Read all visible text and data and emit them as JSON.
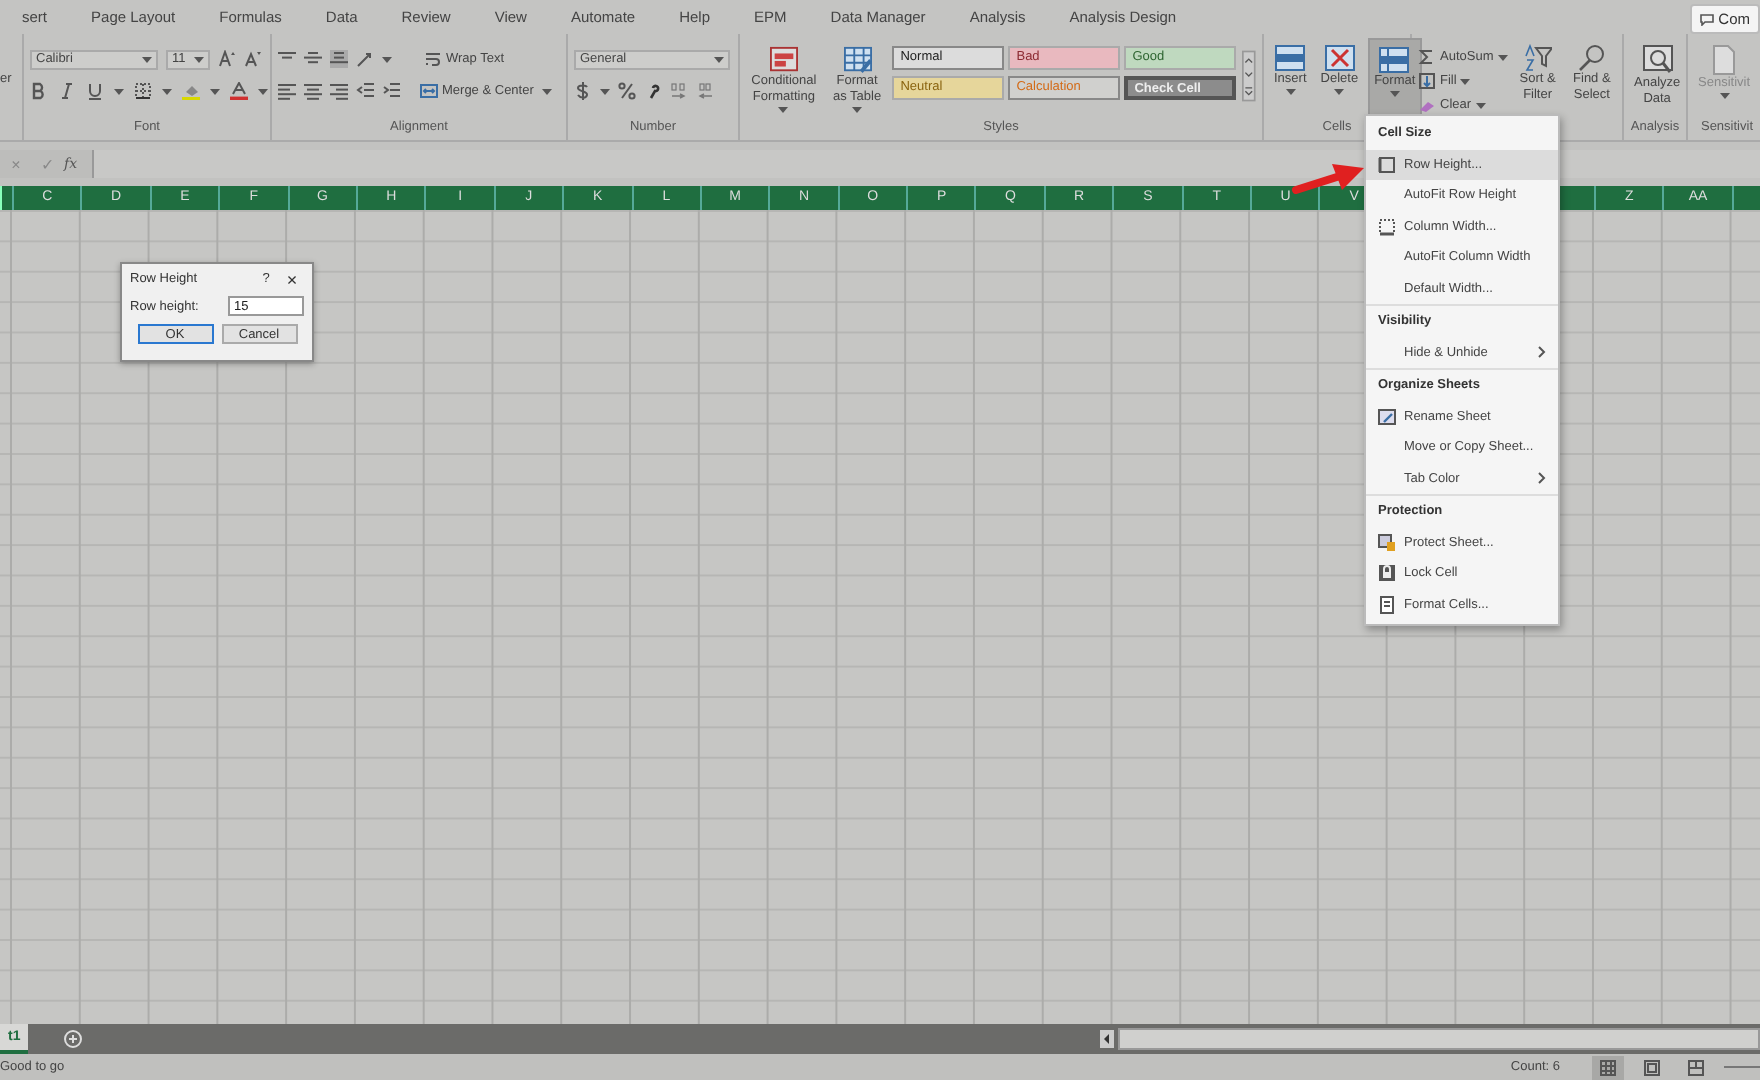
{
  "ribbon_tabs": [
    {
      "label": "sert"
    },
    {
      "label": "Page Layout"
    },
    {
      "label": "Formulas"
    },
    {
      "label": "Data"
    },
    {
      "label": "Review"
    },
    {
      "label": "View"
    },
    {
      "label": "Automate"
    },
    {
      "label": "Help"
    },
    {
      "label": "EPM"
    },
    {
      "label": "Data Manager"
    },
    {
      "label": "Analysis"
    },
    {
      "label": "Analysis Design"
    }
  ],
  "comments_button": "Com",
  "ribbon": {
    "groups": [
      {
        "kind": "clipboard",
        "fragment": "er"
      },
      {
        "kind": "font",
        "font_name": "Calibri",
        "font_size": "11",
        "label": "Font"
      },
      {
        "kind": "alignment",
        "wrap_text": "Wrap Text",
        "merge": "Merge & Center",
        "label": "Alignment"
      },
      {
        "kind": "number",
        "format": "General",
        "label": "Number"
      },
      {
        "kind": "styles",
        "buttons": [
          "Conditional Formatting",
          "Format as Table"
        ],
        "cells": [
          {
            "kind": "normal",
            "label": "Normal"
          },
          {
            "kind": "bad",
            "label": "Bad"
          },
          {
            "kind": "good",
            "label": "Good"
          },
          {
            "kind": "neutral",
            "label": "Neutral"
          },
          {
            "kind": "calculation",
            "label": "Calculation"
          },
          {
            "kind": "check",
            "label": "Check Cell"
          }
        ],
        "label": "Styles"
      },
      {
        "kind": "cells",
        "buttons": [
          {
            "label": "Insert",
            "selected": false
          },
          {
            "label": "Delete",
            "selected": false
          },
          {
            "label": "Format",
            "selected": true
          }
        ],
        "label": "Cells"
      },
      {
        "kind": "editing",
        "items": [
          "AutoSum",
          "Fill",
          "Clear"
        ],
        "buttons": [
          "Sort & Filter",
          "Find & Select"
        ]
      },
      {
        "kind": "analysis",
        "buttons": [
          "Analyze Data"
        ],
        "label": "Analysis"
      },
      {
        "kind": "sensitivity",
        "buttons": [
          "Sensitivit"
        ],
        "label": "Sensitivit"
      }
    ]
  },
  "formula_bar": {
    "cancel": "×",
    "enter": "✓",
    "function": "fx"
  },
  "columns": [
    {
      "kind": "label",
      "label": "C"
    },
    {
      "kind": "label",
      "label": "D"
    },
    {
      "kind": "label",
      "label": "E"
    },
    {
      "kind": "label",
      "label": "F"
    },
    {
      "kind": "label",
      "label": "G"
    },
    {
      "kind": "label",
      "label": "H"
    },
    {
      "kind": "label",
      "label": "I"
    },
    {
      "kind": "label",
      "label": "J"
    },
    {
      "kind": "label",
      "label": "K"
    },
    {
      "kind": "label",
      "label": "L"
    },
    {
      "kind": "label",
      "label": "M"
    },
    {
      "kind": "label",
      "label": "N"
    },
    {
      "kind": "label",
      "label": "O"
    },
    {
      "kind": "label",
      "label": "P"
    },
    {
      "kind": "label",
      "label": "Q"
    },
    {
      "kind": "label",
      "label": "R"
    },
    {
      "kind": "label",
      "label": "S"
    },
    {
      "kind": "label",
      "label": "T"
    },
    {
      "kind": "label",
      "label": "U"
    },
    {
      "kind": "label",
      "label": "V"
    },
    {
      "kind": "covered"
    },
    {
      "kind": "covered"
    },
    {
      "kind": "covered"
    },
    {
      "kind": "label",
      "label": "Z"
    },
    {
      "kind": "label",
      "label": "AA"
    }
  ],
  "dialog": {
    "title": "Row Height",
    "help": "?",
    "close": "×",
    "field_label": "Row height:",
    "value": "15",
    "buttons": [
      {
        "label": "OK",
        "default": true
      },
      {
        "label": "Cancel",
        "default": false
      }
    ]
  },
  "menu": {
    "sections": [
      {
        "title": "Cell Size",
        "items": [
          {
            "kind": "row",
            "label": "Row Height...",
            "submenu": false,
            "selected": true
          },
          {
            "kind": "plain",
            "label": "AutoFit Row Height",
            "submenu": false,
            "selected": false
          },
          {
            "kind": "column",
            "label": "Column Width...",
            "submenu": false,
            "selected": false
          },
          {
            "kind": "plain",
            "label": "AutoFit Column Width",
            "submenu": false,
            "selected": false
          },
          {
            "kind": "plain",
            "label": "Default Width...",
            "submenu": false,
            "selected": false
          }
        ]
      },
      {
        "title": "Visibility",
        "items": [
          {
            "kind": "plain",
            "label": "Hide & Unhide",
            "submenu": true,
            "selected": false
          }
        ]
      },
      {
        "title": "Organize Sheets",
        "items": [
          {
            "kind": "rename",
            "label": "Rename Sheet",
            "submenu": false,
            "selected": false
          },
          {
            "kind": "plain",
            "label": "Move or Copy Sheet...",
            "submenu": false,
            "selected": false
          },
          {
            "kind": "plain",
            "label": "Tab Color",
            "submenu": true,
            "selected": false
          }
        ]
      },
      {
        "title": "Protection",
        "items": [
          {
            "kind": "protect",
            "label": "Protect Sheet...",
            "submenu": false,
            "selected": false
          },
          {
            "kind": "lock",
            "label": "Lock Cell",
            "submenu": false,
            "selected": false
          },
          {
            "kind": "format",
            "label": "Format Cells...",
            "submenu": false,
            "selected": false
          }
        ]
      }
    ]
  },
  "sheet_tabs": [
    {
      "label": "t1",
      "selected": true
    }
  ],
  "status_bar": {
    "message": "Good to go",
    "count": "Count: 6",
    "views": [
      {
        "kind": "normal",
        "selected": true
      },
      {
        "kind": "page_layout",
        "selected": false
      },
      {
        "kind": "page_break",
        "selected": false
      }
    ]
  }
}
